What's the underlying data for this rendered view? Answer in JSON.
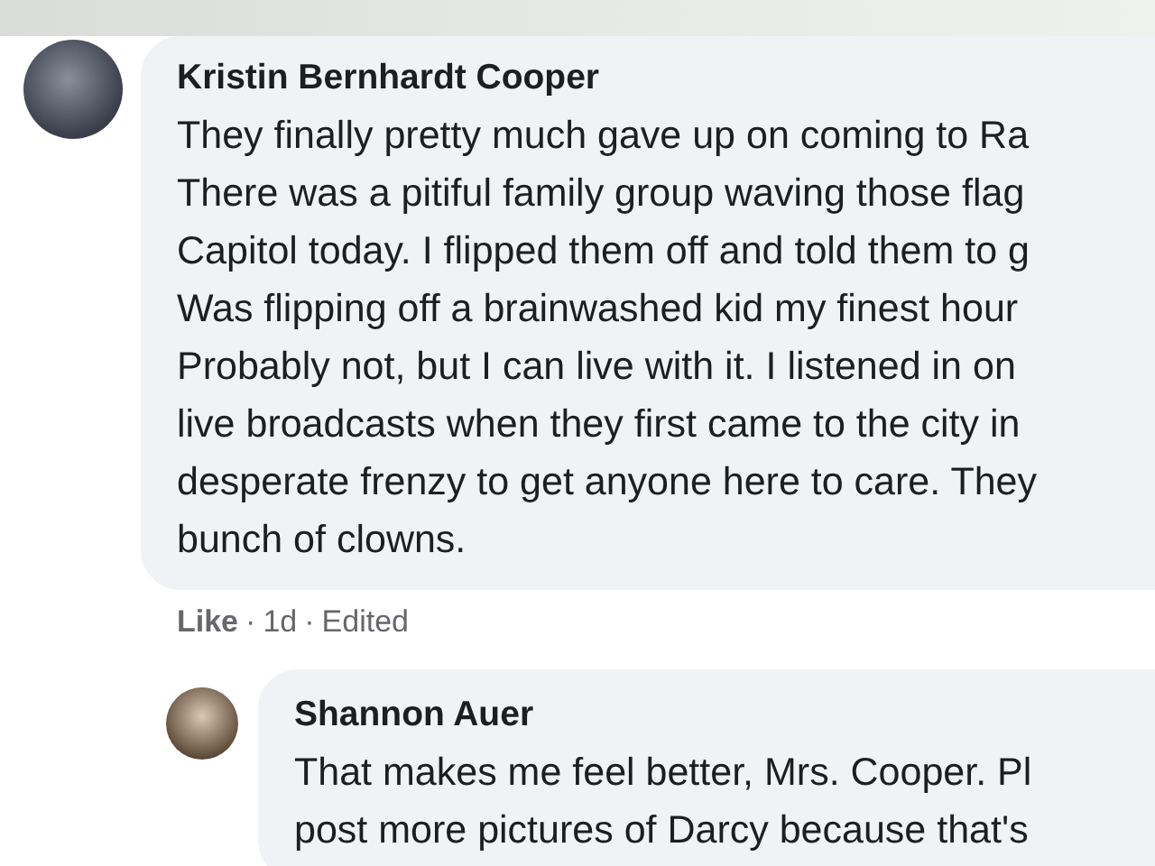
{
  "comments": [
    {
      "author": "Kristin Bernhardt Cooper",
      "text": "They finally pretty much gave up on coming to Ra\nThere was a pitiful family group waving those flag\nCapitol today. I flipped them off and told them to g\nWas flipping off a brainwashed kid my finest hour\nProbably not, but I can live with it. I listened in on\nlive broadcasts when they first came to the city in\ndesperate frenzy to get anyone here to care. They\nbunch of clowns.",
      "actions": [
        {
          "kind": "like",
          "text": "Like"
        },
        {
          "kind": "separator",
          "text": "·"
        },
        {
          "kind": "time",
          "text": "1d"
        },
        {
          "kind": "separator",
          "text": "·"
        },
        {
          "kind": "edited",
          "text": "Edited"
        }
      ],
      "replies": [
        {
          "author": "Shannon Auer",
          "text": "That makes me feel better, Mrs. Cooper. Pl\npost more pictures of Darcy because that's"
        }
      ]
    }
  ]
}
